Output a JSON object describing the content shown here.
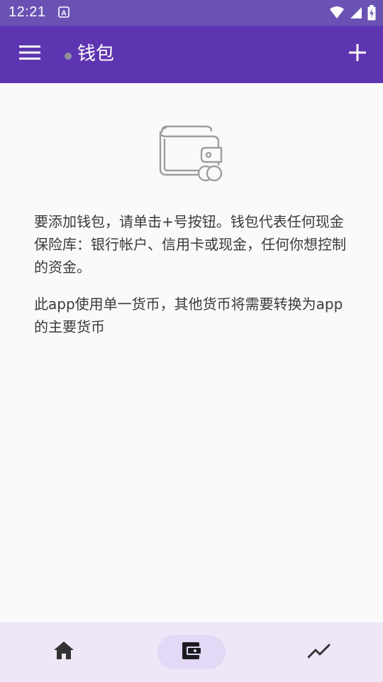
{
  "status_bar": {
    "time": "12:21",
    "notification_icon": "a-letter-icon",
    "icons": [
      "wifi-icon",
      "signal-icon",
      "battery-charging-icon"
    ]
  },
  "app_bar": {
    "title": "钱包",
    "menu_icon": "menu-icon",
    "add_icon": "add-icon"
  },
  "empty_state": {
    "icon": "wallet-icon",
    "paragraphs": [
      "要添加钱包，请单击+号按钮。钱包代表任何现金保险库：银行帐户、信用卡或现金，任何你想控制的资金。",
      "此app使用单一货币，其他货币将需要转换为app的主要货币"
    ]
  },
  "bottom_nav": {
    "items": [
      {
        "icon": "home-icon",
        "active": false
      },
      {
        "icon": "wallet-icon",
        "active": true
      },
      {
        "icon": "trending-icon",
        "active": false
      }
    ]
  },
  "colors": {
    "status_bar": "#6a52b4",
    "app_bar": "#5e35b1",
    "background": "#fafafa",
    "bottom_nav": "#efe6f7",
    "active_pill": "#e3d8f5",
    "text": "#3a3a3a",
    "icon_gray": "#9e9e9e"
  }
}
